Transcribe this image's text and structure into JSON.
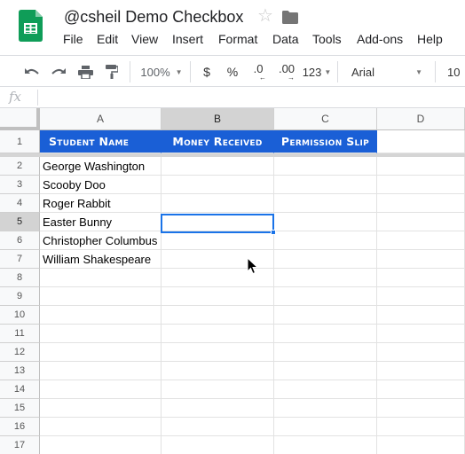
{
  "document": {
    "title": "@csheil Demo Checkbox"
  },
  "menu": {
    "items": [
      "File",
      "Edit",
      "View",
      "Insert",
      "Format",
      "Data",
      "Tools",
      "Add-ons",
      "Help"
    ]
  },
  "toolbar": {
    "zoom": "100%",
    "currency": "$",
    "percent": "%",
    "decimal_decrease": ".0",
    "decimal_increase": ".00",
    "more_formats": "123",
    "font": "Arial",
    "font_size": "10"
  },
  "formula_bar": {
    "fx_label": "fx",
    "value": ""
  },
  "grid": {
    "columns": [
      "A",
      "B",
      "C",
      "D"
    ],
    "selected_column": "B",
    "selected_row": "5",
    "rows": [
      "1",
      "2",
      "3",
      "4",
      "5",
      "6",
      "7",
      "8",
      "9",
      "10",
      "11",
      "12",
      "13",
      "14",
      "15",
      "16",
      "17"
    ],
    "header_row": [
      "Student Name",
      "Money Received",
      "Permission Slip"
    ],
    "students": [
      "George Washington",
      "Scooby Doo",
      "Roger Rabbit",
      "Easter Bunny",
      "Christopher Columbus",
      "William Shakespeare"
    ]
  },
  "colors": {
    "header_fill": "#1a5fd6",
    "selection": "#1a73e8",
    "sheets_green": "#0f9d58"
  }
}
